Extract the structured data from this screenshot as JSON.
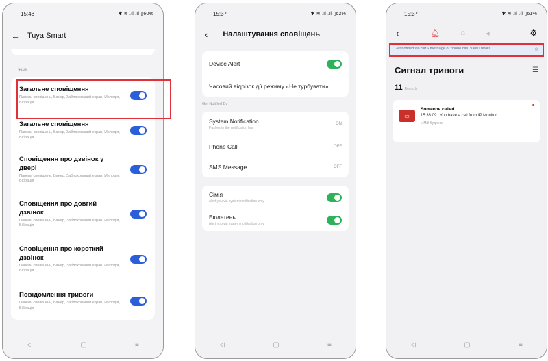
{
  "phone1": {
    "status_time": "15:48",
    "status_right": "✱ ≋ .ıl .ıl ▯60%",
    "header_title": "Tuya Smart",
    "section_label": "Інше",
    "items": [
      {
        "title": "Загальне сповіщення",
        "sub": "Панель сповіщень, Банер, Заблокований екран, Мелодія, Вібрація"
      },
      {
        "title": "Загальне сповіщення",
        "sub": "Панель сповіщень, Банер, Заблокований екран, Мелодія, Вібрація"
      },
      {
        "title": "Сповіщення про дзвінок у двері",
        "sub": "Панель сповіщень, Банер, Заблокований екран, Мелодія, Вібрація"
      },
      {
        "title": "Сповіщення про довгий дзвінок",
        "sub": "Панель сповіщень, Банер, Заблокований екран, Мелодія, Вібрація"
      },
      {
        "title": "Сповіщення про короткий дзвінок",
        "sub": "Панель сповіщень, Банер, Заблокований екран, Мелодія, Вібрація"
      },
      {
        "title": "Повідомлення тривоги",
        "sub": "Панель сповіщень, Банер, Заблокований екран, Мелодія, Вібрація"
      }
    ]
  },
  "phone2": {
    "status_time": "15:37",
    "status_right": "✱ ≋ .ıl .ıl ▯62%",
    "header_title": "Налаштування сповіщень",
    "device_alert": "Device Alert",
    "dnd": "Часовий відрізок дії режиму «Не турбувати»",
    "get_notified": "Get Notified By",
    "system_notification": "System Notification",
    "system_notification_sub": "Pushes to the notification bar",
    "system_notification_val": "ON",
    "phone_call": "Phone Call",
    "phone_call_val": "OFF",
    "sms": "SMS Message",
    "sms_val": "OFF",
    "family": "Сім'я",
    "family_sub": "Alert you via system notification only",
    "bulletin": "Бюлетень",
    "bulletin_sub": "Alert you via system notification only"
  },
  "phone3": {
    "status_time": "15:37",
    "status_right": "✱ ≋ .ıl .ıl ▯61%",
    "banner": "Get notified via SMS message or phone call. View Details",
    "title": "Сигнал тривоги",
    "count": "11",
    "count_label": "Records",
    "event_title": "Someone called",
    "event_desc": "15:33:09 | You have a call from IP Monitor",
    "event_location": "Мій будинок"
  },
  "icons": {
    "back": "←",
    "chevron": "›",
    "bell": "●",
    "home": "⌂",
    "speaker": "◂",
    "gear": "⚙",
    "filter": "☰",
    "close": "⊗",
    "nav_back": "◁",
    "nav_home": "▢",
    "nav_menu": "≡"
  }
}
